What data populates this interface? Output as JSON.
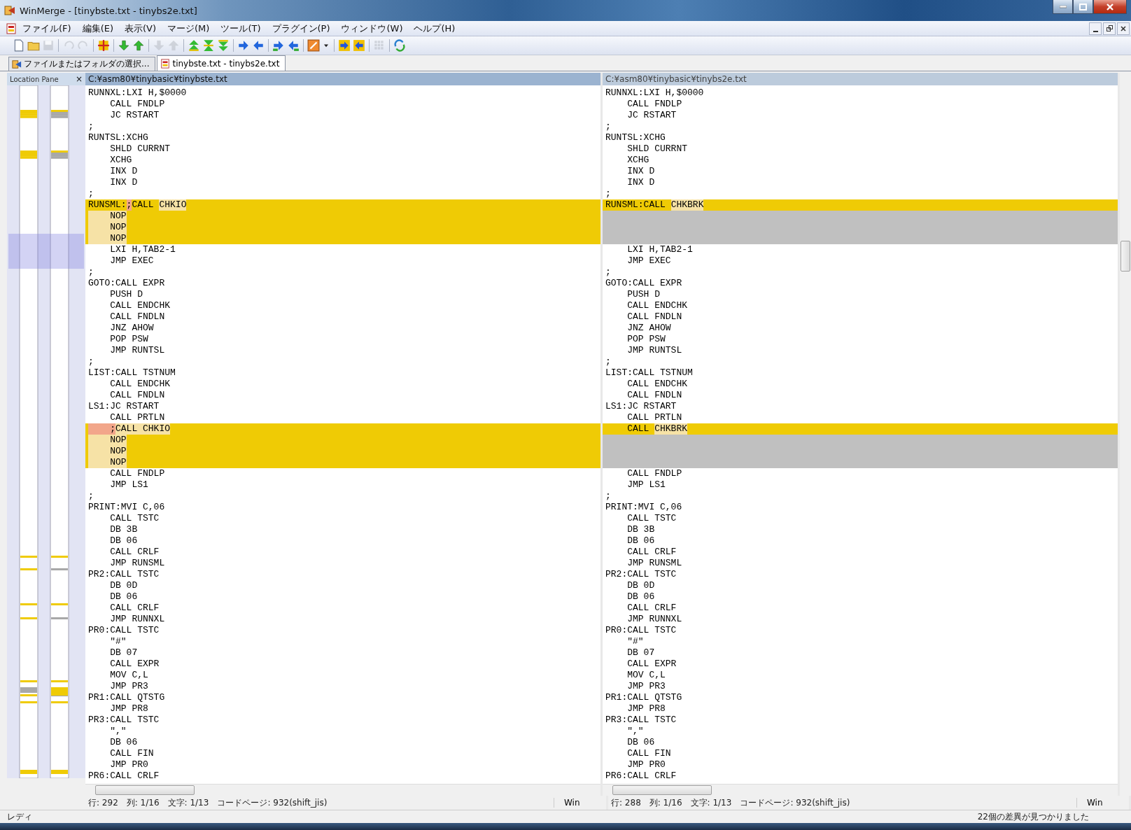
{
  "window": {
    "title": "WinMerge - [tinybste.txt - tinybs2e.txt]"
  },
  "menu": [
    "ファイル(F)",
    "編集(E)",
    "表示(V)",
    "マージ(M)",
    "ツール(T)",
    "プラグイン(P)",
    "ウィンドウ(W)",
    "ヘルプ(H)"
  ],
  "toolbar": [
    {
      "kind": "page",
      "disabled": false
    },
    {
      "kind": "folder",
      "disabled": false
    },
    {
      "kind": "save",
      "disabled": true
    },
    {
      "kind": "separator"
    },
    {
      "kind": "undo",
      "disabled": true
    },
    {
      "kind": "redo",
      "disabled": true
    },
    {
      "kind": "separator"
    },
    {
      "kind": "mark",
      "disabled": false
    },
    {
      "kind": "separator"
    },
    {
      "kind": "down",
      "disabled": false
    },
    {
      "kind": "up",
      "disabled": false
    },
    {
      "kind": "separator"
    },
    {
      "kind": "down",
      "disabled": true
    },
    {
      "kind": "up",
      "disabled": true
    },
    {
      "kind": "separator"
    },
    {
      "kind": "first",
      "disabled": false
    },
    {
      "kind": "current",
      "disabled": false
    },
    {
      "kind": "last",
      "disabled": false
    },
    {
      "kind": "separator"
    },
    {
      "kind": "right",
      "disabled": false
    },
    {
      "kind": "left",
      "disabled": false
    },
    {
      "kind": "separator"
    },
    {
      "kind": "right-next",
      "disabled": false
    },
    {
      "kind": "left-next",
      "disabled": false
    },
    {
      "kind": "separator"
    },
    {
      "kind": "options",
      "disabled": false
    },
    {
      "kind": "dropdown",
      "disabled": false
    },
    {
      "kind": "separator"
    },
    {
      "kind": "next-file",
      "disabled": false
    },
    {
      "kind": "prev-file",
      "disabled": false
    },
    {
      "kind": "separator"
    },
    {
      "kind": "grid",
      "disabled": true
    },
    {
      "kind": "separator"
    },
    {
      "kind": "refresh",
      "disabled": false
    }
  ],
  "tabs": [
    {
      "label": "ファイルまたはフォルダの選択...",
      "kind": "open",
      "selected": false
    },
    {
      "label": "tinybste.txt - tinybs2e.txt",
      "kind": "compare",
      "selected": true
    }
  ],
  "location_pane": {
    "title": "Location Pane",
    "close": "×"
  },
  "panes": [
    {
      "path": "C:¥asm80¥tinybasic¥tinybste.txt",
      "active": true,
      "status": [
        "行: 292",
        "列: 1/16",
        "文字: 1/13",
        "コードページ: 932(shift_jis)"
      ],
      "eol": "Win"
    },
    {
      "path": "C:¥asm80¥tinybasic¥tinybs2e.txt",
      "active": false,
      "status": [
        "行: 288",
        "列: 1/16",
        "文字: 1/13",
        "コードページ: 932(shift_jis)"
      ],
      "eol": "Win"
    }
  ],
  "lines": [
    {
      "kind": "same",
      "left": "RUNNXL:LXI H,$0000",
      "right": "RUNNXL:LXI H,$0000"
    },
    {
      "kind": "same",
      "left": "    CALL FNDLP",
      "right": "    CALL FNDLP"
    },
    {
      "kind": "same",
      "left": "    JC RSTART",
      "right": "    JC RSTART"
    },
    {
      "kind": "same",
      "left": ";",
      "right": ";"
    },
    {
      "kind": "same",
      "left": "RUNTSL:XCHG",
      "right": "RUNTSL:XCHG"
    },
    {
      "kind": "same",
      "left": "    SHLD CURRNT",
      "right": "    SHLD CURRNT"
    },
    {
      "kind": "same",
      "left": "    XCHG",
      "right": "    XCHG"
    },
    {
      "kind": "same",
      "left": "    INX D",
      "right": "    INX D"
    },
    {
      "kind": "same",
      "left": "    INX D",
      "right": "    INX D"
    },
    {
      "kind": "same",
      "left": ";",
      "right": ";"
    },
    {
      "kind": "diff",
      "left": [
        {
          "text": "RUNSML:",
          "kind": "plain"
        },
        {
          "text": ";",
          "kind": "char"
        },
        {
          "text": "CALL ",
          "kind": "plain"
        },
        {
          "text": "CHKIO",
          "kind": "word"
        }
      ],
      "right": [
        {
          "text": "RUNSML:CALL ",
          "kind": "plain"
        },
        {
          "text": "CHKBRK",
          "kind": "word"
        }
      ]
    },
    {
      "kind": "removed",
      "left": [
        {
          "text": "    NOP",
          "kind": "word"
        }
      ]
    },
    {
      "kind": "removed",
      "left": [
        {
          "text": "    NOP",
          "kind": "word"
        }
      ]
    },
    {
      "kind": "removed",
      "left": [
        {
          "text": "    NOP",
          "kind": "word"
        }
      ]
    },
    {
      "kind": "same",
      "left": "    LXI H,TAB2-1",
      "right": "    LXI H,TAB2-1"
    },
    {
      "kind": "same",
      "left": "    JMP EXEC",
      "right": "    JMP EXEC"
    },
    {
      "kind": "same",
      "left": ";",
      "right": ";"
    },
    {
      "kind": "same",
      "left": "GOTO:CALL EXPR",
      "right": "GOTO:CALL EXPR"
    },
    {
      "kind": "same",
      "left": "    PUSH D",
      "right": "    PUSH D"
    },
    {
      "kind": "same",
      "left": "    CALL ENDCHK",
      "right": "    CALL ENDCHK"
    },
    {
      "kind": "same",
      "left": "    CALL FNDLN",
      "right": "    CALL FNDLN"
    },
    {
      "kind": "same",
      "left": "    JNZ AHOW",
      "right": "    JNZ AHOW"
    },
    {
      "kind": "same",
      "left": "    POP PSW",
      "right": "    POP PSW"
    },
    {
      "kind": "same",
      "left": "    JMP RUNTSL",
      "right": "    JMP RUNTSL"
    },
    {
      "kind": "same",
      "left": ";",
      "right": ";"
    },
    {
      "kind": "same",
      "left": "LIST:CALL TSTNUM",
      "right": "LIST:CALL TSTNUM"
    },
    {
      "kind": "same",
      "left": "    CALL ENDCHK",
      "right": "    CALL ENDCHK"
    },
    {
      "kind": "same",
      "left": "    CALL FNDLN",
      "right": "    CALL FNDLN"
    },
    {
      "kind": "same",
      "left": "LS1:JC RSTART",
      "right": "LS1:JC RSTART"
    },
    {
      "kind": "same",
      "left": "    CALL PRTLN",
      "right": "    CALL PRTLN"
    },
    {
      "kind": "diff",
      "left": [
        {
          "text": "    ;",
          "kind": "char"
        },
        {
          "text": "CALL CHKIO",
          "kind": "word"
        }
      ],
      "right": [
        {
          "text": "    CALL ",
          "kind": "plain"
        },
        {
          "text": "CHKBRK",
          "kind": "word"
        }
      ]
    },
    {
      "kind": "removed",
      "left": [
        {
          "text": "    NOP",
          "kind": "word"
        }
      ]
    },
    {
      "kind": "removed",
      "left": [
        {
          "text": "    NOP",
          "kind": "word"
        }
      ]
    },
    {
      "kind": "removed",
      "left": [
        {
          "text": "    NOP",
          "kind": "word"
        }
      ]
    },
    {
      "kind": "same",
      "left": "    CALL FNDLP",
      "right": "    CALL FNDLP"
    },
    {
      "kind": "same",
      "left": "    JMP LS1",
      "right": "    JMP LS1"
    },
    {
      "kind": "same",
      "left": ";",
      "right": ";"
    },
    {
      "kind": "same",
      "left": "PRINT:MVI C,06",
      "right": "PRINT:MVI C,06"
    },
    {
      "kind": "same",
      "left": "    CALL TSTC",
      "right": "    CALL TSTC"
    },
    {
      "kind": "same",
      "left": "    DB 3B",
      "right": "    DB 3B"
    },
    {
      "kind": "same",
      "left": "    DB 06",
      "right": "    DB 06"
    },
    {
      "kind": "same",
      "left": "    CALL CRLF",
      "right": "    CALL CRLF"
    },
    {
      "kind": "same",
      "left": "    JMP RUNSML",
      "right": "    JMP RUNSML"
    },
    {
      "kind": "same",
      "left": "PR2:CALL TSTC",
      "right": "PR2:CALL TSTC"
    },
    {
      "kind": "same",
      "left": "    DB 0D",
      "right": "    DB 0D"
    },
    {
      "kind": "same",
      "left": "    DB 06",
      "right": "    DB 06"
    },
    {
      "kind": "same",
      "left": "    CALL CRLF",
      "right": "    CALL CRLF"
    },
    {
      "kind": "same",
      "left": "    JMP RUNNXL",
      "right": "    JMP RUNNXL"
    },
    {
      "kind": "same",
      "left": "PR0:CALL TSTC",
      "right": "PR0:CALL TSTC"
    },
    {
      "kind": "same",
      "left": "    \"#\"",
      "right": "    \"#\""
    },
    {
      "kind": "same",
      "left": "    DB 07",
      "right": "    DB 07"
    },
    {
      "kind": "same",
      "left": "    CALL EXPR",
      "right": "    CALL EXPR"
    },
    {
      "kind": "same",
      "left": "    MOV C,L",
      "right": "    MOV C,L"
    },
    {
      "kind": "same",
      "left": "    JMP PR3",
      "right": "    JMP PR3"
    },
    {
      "kind": "same",
      "left": "PR1:CALL QTSTG",
      "right": "PR1:CALL QTSTG"
    },
    {
      "kind": "same",
      "left": "    JMP PR8",
      "right": "    JMP PR8"
    },
    {
      "kind": "same",
      "left": "PR3:CALL TSTC",
      "right": "PR3:CALL TSTC"
    },
    {
      "kind": "same",
      "left": "    \",\"",
      "right": "    \",\""
    },
    {
      "kind": "same",
      "left": "    DB 06",
      "right": "    DB 06"
    },
    {
      "kind": "same",
      "left": "    CALL FIN",
      "right": "    CALL FIN"
    },
    {
      "kind": "same",
      "left": "    JMP PR0",
      "right": "    JMP PR0"
    },
    {
      "kind": "same",
      "left": "PR6:CALL CRLF",
      "right": "PR6:CALL CRLF"
    }
  ],
  "status_bar": {
    "state": "レディ",
    "message": "22個の差異が見つかりました"
  }
}
